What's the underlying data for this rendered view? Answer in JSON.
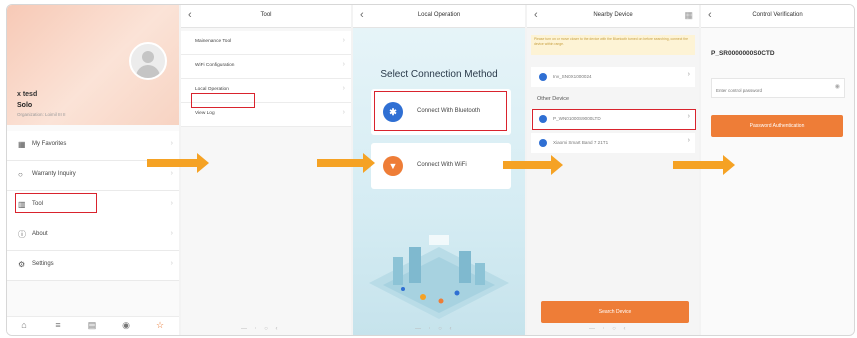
{
  "colors": {
    "accent": "#ee7d37",
    "arrow": "#f5a224",
    "highlight": "#d9232d",
    "bluetooth": "#2f6fd3"
  },
  "screen1": {
    "user_name": "x tesd",
    "role": "Solo",
    "org": "Organization: Loimil III II",
    "menu": [
      {
        "icon": "book-icon",
        "label": "My Favorites"
      },
      {
        "icon": "warranty-icon",
        "label": "Warranty Inquiry"
      },
      {
        "icon": "tool-icon",
        "label": "Tool"
      },
      {
        "icon": "info-icon",
        "label": "About"
      },
      {
        "icon": "gear-icon",
        "label": "Settings"
      }
    ],
    "tabs": [
      {
        "icon": "home-icon"
      },
      {
        "icon": "list-icon"
      },
      {
        "icon": "device-icon"
      },
      {
        "icon": "settings-icon"
      },
      {
        "icon": "user-icon"
      }
    ]
  },
  "screen2": {
    "title": "Tool",
    "items": [
      "Mainenance Tool",
      "WiFi Configuration",
      "Local Operation",
      "View Log"
    ]
  },
  "screen3": {
    "title": "Local Operation",
    "heading": "Select Connection Method",
    "bluetooth_label": "Connect With Bluetooth",
    "wifi_label": "Connect With WiFi"
  },
  "screen4": {
    "title": "Nearby Device",
    "warning": "Please turn on or move closer to the device with the Bluetooth turned on before searching, connect the device within range.",
    "devices_top": [
      "Inv_SN0X1000024"
    ],
    "section_label": "Other Device",
    "other_devices": [
      "P_WN01000S9000LTD",
      "Xiaomi Smart Band 7 21T1"
    ],
    "search_button": "Search Device"
  },
  "screen5": {
    "title": "Control Verification",
    "device_id": "P_SR0000000S0CTD",
    "password_placeholder": "Enter control password",
    "auth_button": "Password Authentication"
  }
}
